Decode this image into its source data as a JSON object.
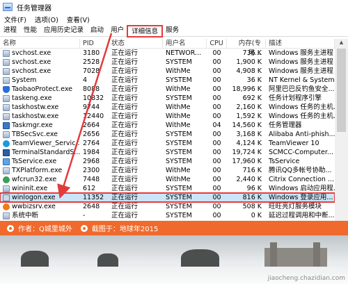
{
  "window": {
    "title": "任务管理器"
  },
  "menu": [
    "文件(F)",
    "选项(O)",
    "查看(V)"
  ],
  "tabs": [
    "进程",
    "性能",
    "应用历史记录",
    "启动",
    "用户",
    "详细信息",
    "服务"
  ],
  "active_tab_index": 5,
  "columns": [
    "名称",
    "PID",
    "状态",
    "用户名",
    "CPU",
    "内存(专用...",
    "描述"
  ],
  "rows": [
    {
      "icon": "box",
      "name": "svchost.exe",
      "pid": "3180",
      "status": "正在运行",
      "user": "NETWOR...",
      "cpu": "00",
      "mem": "736 K",
      "desc": "Windows 服务主进程"
    },
    {
      "icon": "box",
      "name": "svchost.exe",
      "pid": "2528",
      "status": "正在运行",
      "user": "SYSTEM",
      "cpu": "00",
      "mem": "1,900 K",
      "desc": "Windows 服务主进程"
    },
    {
      "icon": "box",
      "name": "svchost.exe",
      "pid": "7028",
      "status": "正在运行",
      "user": "WithMe",
      "cpu": "00",
      "mem": "4,908 K",
      "desc": "Windows 服务主进程"
    },
    {
      "icon": "box",
      "name": "System",
      "pid": "4",
      "status": "正在运行",
      "user": "SYSTEM",
      "cpu": "00",
      "mem": "36 K",
      "desc": "NT Kernel & System"
    },
    {
      "icon": "shield",
      "name": "TaobaoProtect.exe",
      "pid": "8088",
      "status": "正在运行",
      "user": "WithMe",
      "cpu": "00",
      "mem": "18,996 K",
      "desc": "阿里巴巴反钓鱼安全..."
    },
    {
      "icon": "box",
      "name": "taskeng.exe",
      "pid": "10832",
      "status": "正在运行",
      "user": "SYSTEM",
      "cpu": "00",
      "mem": "692 K",
      "desc": "任务计划程序引擎"
    },
    {
      "icon": "box",
      "name": "taskhostw.exe",
      "pid": "9744",
      "status": "正在运行",
      "user": "WithMe",
      "cpu": "00",
      "mem": "2,160 K",
      "desc": "Windows 任务的主机..."
    },
    {
      "icon": "box",
      "name": "taskhostw.exe",
      "pid": "12440",
      "status": "正在运行",
      "user": "WithMe",
      "cpu": "00",
      "mem": "1,592 K",
      "desc": "Windows 任务的主机..."
    },
    {
      "icon": "monitor",
      "name": "Taskmgr.exe",
      "pid": "2664",
      "status": "正在运行",
      "user": "WithMe",
      "cpu": "04",
      "mem": "14,560 K",
      "desc": "任务管理器"
    },
    {
      "icon": "box",
      "name": "TBSecSvc.exe",
      "pid": "2656",
      "status": "正在运行",
      "user": "SYSTEM",
      "cpu": "00",
      "mem": "3,168 K",
      "desc": "Alibaba Anti-phish..."
    },
    {
      "icon": "circle",
      "name": "TeamViewer_Servic...",
      "pid": "2764",
      "status": "正在运行",
      "user": "SYSTEM",
      "cpu": "00",
      "mem": "4,124 K",
      "desc": "TeamViewer 10"
    },
    {
      "icon": "terminal",
      "name": "TerminalStandardS...",
      "pid": "1984",
      "status": "正在运行",
      "user": "SYSTEM",
      "cpu": "00",
      "mem": "19,724 K",
      "desc": "SCMCC-Computer..."
    },
    {
      "icon": "ts",
      "name": "TsService.exe",
      "pid": "2968",
      "status": "正在运行",
      "user": "SYSTEM",
      "cpu": "00",
      "mem": "17,960 K",
      "desc": "TsService"
    },
    {
      "icon": "box",
      "name": "TXPlatform.exe",
      "pid": "2300",
      "status": "正在运行",
      "user": "WithMe",
      "cpu": "00",
      "mem": "716 K",
      "desc": "腾讯QQ多帐号协助..."
    },
    {
      "icon": "wf",
      "name": "wfcrun32.exe",
      "pid": "7448",
      "status": "正在运行",
      "user": "WithMe",
      "cpu": "00",
      "mem": "2,440 K",
      "desc": "Citrix Connection ..."
    },
    {
      "icon": "box",
      "name": "wininit.exe",
      "pid": "612",
      "status": "正在运行",
      "user": "SYSTEM",
      "cpu": "00",
      "mem": "96 K",
      "desc": "Windows 启动应用程..."
    },
    {
      "icon": "winlogon",
      "name": "winlogon.exe",
      "pid": "11352",
      "status": "正在运行",
      "user": "SYSTEM",
      "cpu": "00",
      "mem": "816 K",
      "desc": "Windows 登录应用..."
    },
    {
      "icon": "wwbiz",
      "name": "wwbizsrv.exe",
      "pid": "2648",
      "status": "正在运行",
      "user": "SYSTEM",
      "cpu": "00",
      "mem": "508 K",
      "desc": "旺旺亮灯服务模块"
    },
    {
      "icon": "box",
      "name": "系统中断",
      "pid": "-",
      "status": "正在运行",
      "user": "SYSTEM",
      "cpu": "00",
      "mem": "0 K",
      "desc": "延迟过程调用和中断..."
    }
  ],
  "selected_row_index": 16,
  "banner": {
    "author": "作者：Q城里城外",
    "screenshot_by": "截图于：地球年2015"
  },
  "watermark": "jiaocheng.chazidian.com",
  "colors": {
    "selection": "#cce4f7",
    "highlight_red": "#e23b3b",
    "banner": "#ef6a2c"
  }
}
